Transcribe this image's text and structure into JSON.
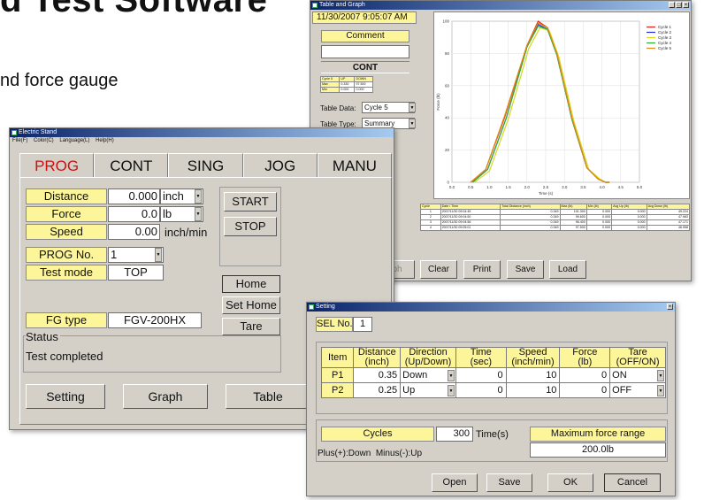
{
  "page": {
    "heading": "d Test Software",
    "subtext": "nd force gauge"
  },
  "electric_stand": {
    "title": "Electric Stand",
    "menu": [
      "File(F)",
      "Color(C)",
      "Language(L)",
      "Help(H)"
    ],
    "tabs": [
      "PROG",
      "CONT",
      "SING",
      "JOG",
      "MANU"
    ],
    "active_tab": "PROG",
    "distance": {
      "label": "Distance",
      "value": "0.000",
      "unit": "inch"
    },
    "force": {
      "label": "Force",
      "value": "0.0",
      "unit": "lb"
    },
    "speed": {
      "label": "Speed",
      "value": "0.00",
      "unit": "inch/min"
    },
    "prog_no": {
      "label": "PROG No.",
      "value": "1"
    },
    "test_mode": {
      "label": "Test mode",
      "value": "TOP"
    },
    "fg_type": {
      "label": "FG type",
      "value": "FGV-200HX"
    },
    "status": {
      "label": "Status",
      "value": "Test completed"
    },
    "buttons": {
      "start": "START",
      "stop": "STOP",
      "home": "Home",
      "set_home": "Set Home",
      "tare": "Tare",
      "setting": "Setting",
      "graph": "Graph",
      "table": "Table"
    }
  },
  "table_graph": {
    "title": "Table and Graph",
    "timestamp": "11/30/2007 9:05:07 AM",
    "comment_label": "Comment",
    "comment_value": "",
    "mode": "CONT",
    "mini_table": [
      [
        "Cycle 5",
        "UP",
        "DOWN"
      ],
      [
        "Max",
        "0.330",
        "97.500"
      ],
      [
        "Min",
        "0.000",
        "0.000"
      ]
    ],
    "table_data": {
      "label": "Table Data:",
      "value": "Cycle 5"
    },
    "table_type": {
      "label": "Table Type:",
      "value": "Summary"
    },
    "buttons": {
      "graph": "ph",
      "clear": "Clear",
      "print": "Print",
      "save": "Save",
      "load": "Load"
    },
    "table_headers": [
      "Cycle",
      "Date / Time",
      "Total Distance (inch)",
      "Max (lb)",
      "Min (lb)",
      "Avg Up (lb)",
      "Avg Down (lb)"
    ],
    "table_rows": [
      [
        "1",
        "2007/11/30 09:04:45",
        "0.349",
        "101.300",
        "0.000",
        "0.000",
        "49.224"
      ],
      [
        "2",
        "2007/11/30 09:04:50",
        "0.349",
        "99.600",
        "0.000",
        "0.000",
        "47.983"
      ],
      [
        "3",
        "2007/11/30 09:04:56",
        "0.349",
        "96.400",
        "0.000",
        "0.000",
        "47.171"
      ],
      [
        "4",
        "2007/11/30 09:05:01",
        "0.349",
        "97.500",
        "0.000",
        "0.000",
        "46.958"
      ]
    ]
  },
  "chart_data": {
    "type": "line",
    "title": "",
    "xlabel": "Time (s)",
    "ylabel": "Force (lb)",
    "xlim": [
      0,
      5.0
    ],
    "ylim": [
      0,
      100
    ],
    "x_ticks": [
      "0.0",
      "0.5",
      "1.0",
      "1.5",
      "2.0",
      "2.5",
      "3.0",
      "3.5",
      "4.0",
      "4.5",
      "5.0"
    ],
    "y_ticks": [
      "0",
      "20",
      "40",
      "60",
      "80",
      "100"
    ],
    "legend_position": "top-right",
    "series": [
      {
        "name": "Cycle 1",
        "color": "#e02020",
        "x": [
          0.5,
          0.9,
          1.4,
          2.0,
          2.3,
          2.55,
          2.8,
          3.2,
          3.6,
          3.9,
          4.1,
          4.2
        ],
        "y": [
          0,
          8,
          40,
          85,
          100,
          96,
          80,
          40,
          9,
          2,
          0,
          0
        ]
      },
      {
        "name": "Cycle 2",
        "color": "#2030d0",
        "x": [
          0.55,
          0.95,
          1.45,
          2.0,
          2.3,
          2.55,
          2.8,
          3.2,
          3.6,
          3.9,
          4.1,
          4.2
        ],
        "y": [
          0,
          8,
          40,
          84,
          98,
          95,
          79,
          39,
          9,
          2,
          0,
          0
        ]
      },
      {
        "name": "Cycle 3",
        "color": "#d8d820",
        "x": [
          0.6,
          1.0,
          1.5,
          2.05,
          2.35,
          2.6,
          2.85,
          3.25,
          3.65,
          3.95,
          4.1,
          4.2
        ],
        "y": [
          0,
          7,
          39,
          83,
          96,
          94,
          78,
          38,
          8,
          2,
          0,
          0
        ]
      },
      {
        "name": "Cycle 4",
        "color": "#30b030",
        "x": [
          0.55,
          0.95,
          1.45,
          2.0,
          2.3,
          2.55,
          2.8,
          3.2,
          3.6,
          3.9,
          4.1,
          4.2
        ],
        "y": [
          0,
          8,
          40,
          84,
          97,
          95,
          79,
          39,
          9,
          2,
          0,
          0
        ]
      },
      {
        "name": "Cycle 5",
        "color": "#e08a10",
        "x": [
          0.5,
          0.9,
          1.4,
          2.0,
          2.3,
          2.55,
          2.8,
          3.2,
          3.6,
          3.9,
          4.1,
          4.2
        ],
        "y": [
          0,
          8,
          41,
          85,
          99,
          96,
          80,
          40,
          9,
          2,
          0,
          0
        ]
      }
    ]
  },
  "setting": {
    "title": "Setting",
    "sel_no": {
      "label": "SEL No.",
      "value": "1"
    },
    "headers": [
      "Item",
      "Distance (inch)",
      "Direction (Up/Down)",
      "Time (sec)",
      "Speed (inch/min)",
      "Force (lb)",
      "Tare (OFF/ON)"
    ],
    "header_lines": [
      [
        "Item"
      ],
      [
        "Distance",
        "(inch)"
      ],
      [
        "Direction",
        "(Up/Down)"
      ],
      [
        "Time",
        "(sec)"
      ],
      [
        "Speed",
        "(inch/min)"
      ],
      [
        "Force",
        "(lb)"
      ],
      [
        "Tare",
        "(OFF/ON)"
      ]
    ],
    "rows": [
      {
        "item": "P1",
        "distance": "0.35",
        "direction": "Down",
        "time": "0",
        "speed": "10",
        "force": "0",
        "tare": "ON"
      },
      {
        "item": "P2",
        "distance": "0.25",
        "direction": "Up",
        "time": "0",
        "speed": "10",
        "force": "0",
        "tare": "OFF"
      }
    ],
    "cycles": {
      "label": "Cycles",
      "value": "300",
      "unit": "Time(s)"
    },
    "max_force": {
      "label": "Maximum force range",
      "value": "200.0lb"
    },
    "note": "Plus(+):Down  Minus(-):Up",
    "buttons": {
      "open": "Open",
      "save": "Save",
      "ok": "OK",
      "cancel": "Cancel"
    }
  }
}
